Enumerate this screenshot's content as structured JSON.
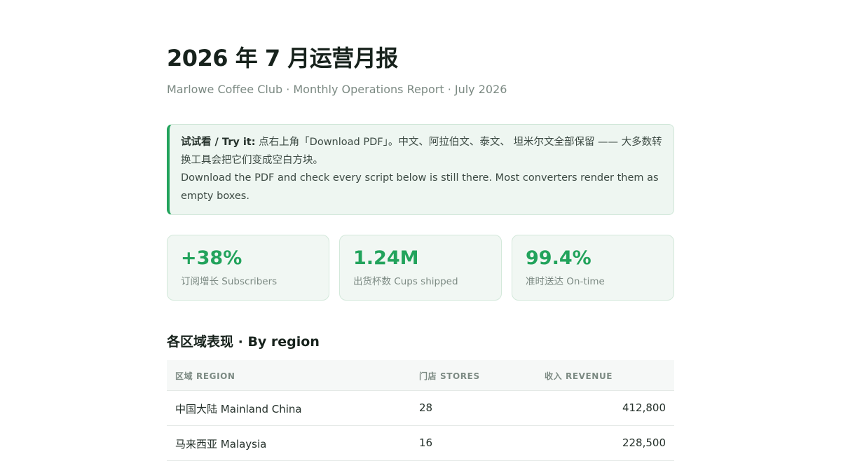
{
  "title": "2026 年 7 月运营月报",
  "subtitle": "Marlowe Coffee Club · Monthly Operations Report · July 2026",
  "callout": {
    "lead": "试试看 / Try it:",
    "zh": " 点右上角「Download PDF」。中文、阿拉伯文、泰文、 坦米尔文全部保留 —— 大多数转换工具会把它们变成空白方块。",
    "en": "Download the PDF and check every script below is still there. Most converters render them as empty boxes."
  },
  "stats": [
    {
      "value": "+38%",
      "label": "订阅增长 Subscribers"
    },
    {
      "value": "1.24M",
      "label": "出货杯数 Cups shipped"
    },
    {
      "value": "99.4%",
      "label": "准时送达 On-time"
    }
  ],
  "region_section": {
    "heading": "各区域表现 · By region",
    "columns": [
      "区域 Region",
      "门店 Stores",
      "收入 Revenue"
    ],
    "rows": [
      {
        "region": "中国大陆 Mainland China",
        "stores": "28",
        "revenue": "412,800"
      },
      {
        "region": "马来西亚 Malaysia",
        "stores": "16",
        "revenue": "228,500"
      }
    ]
  }
}
